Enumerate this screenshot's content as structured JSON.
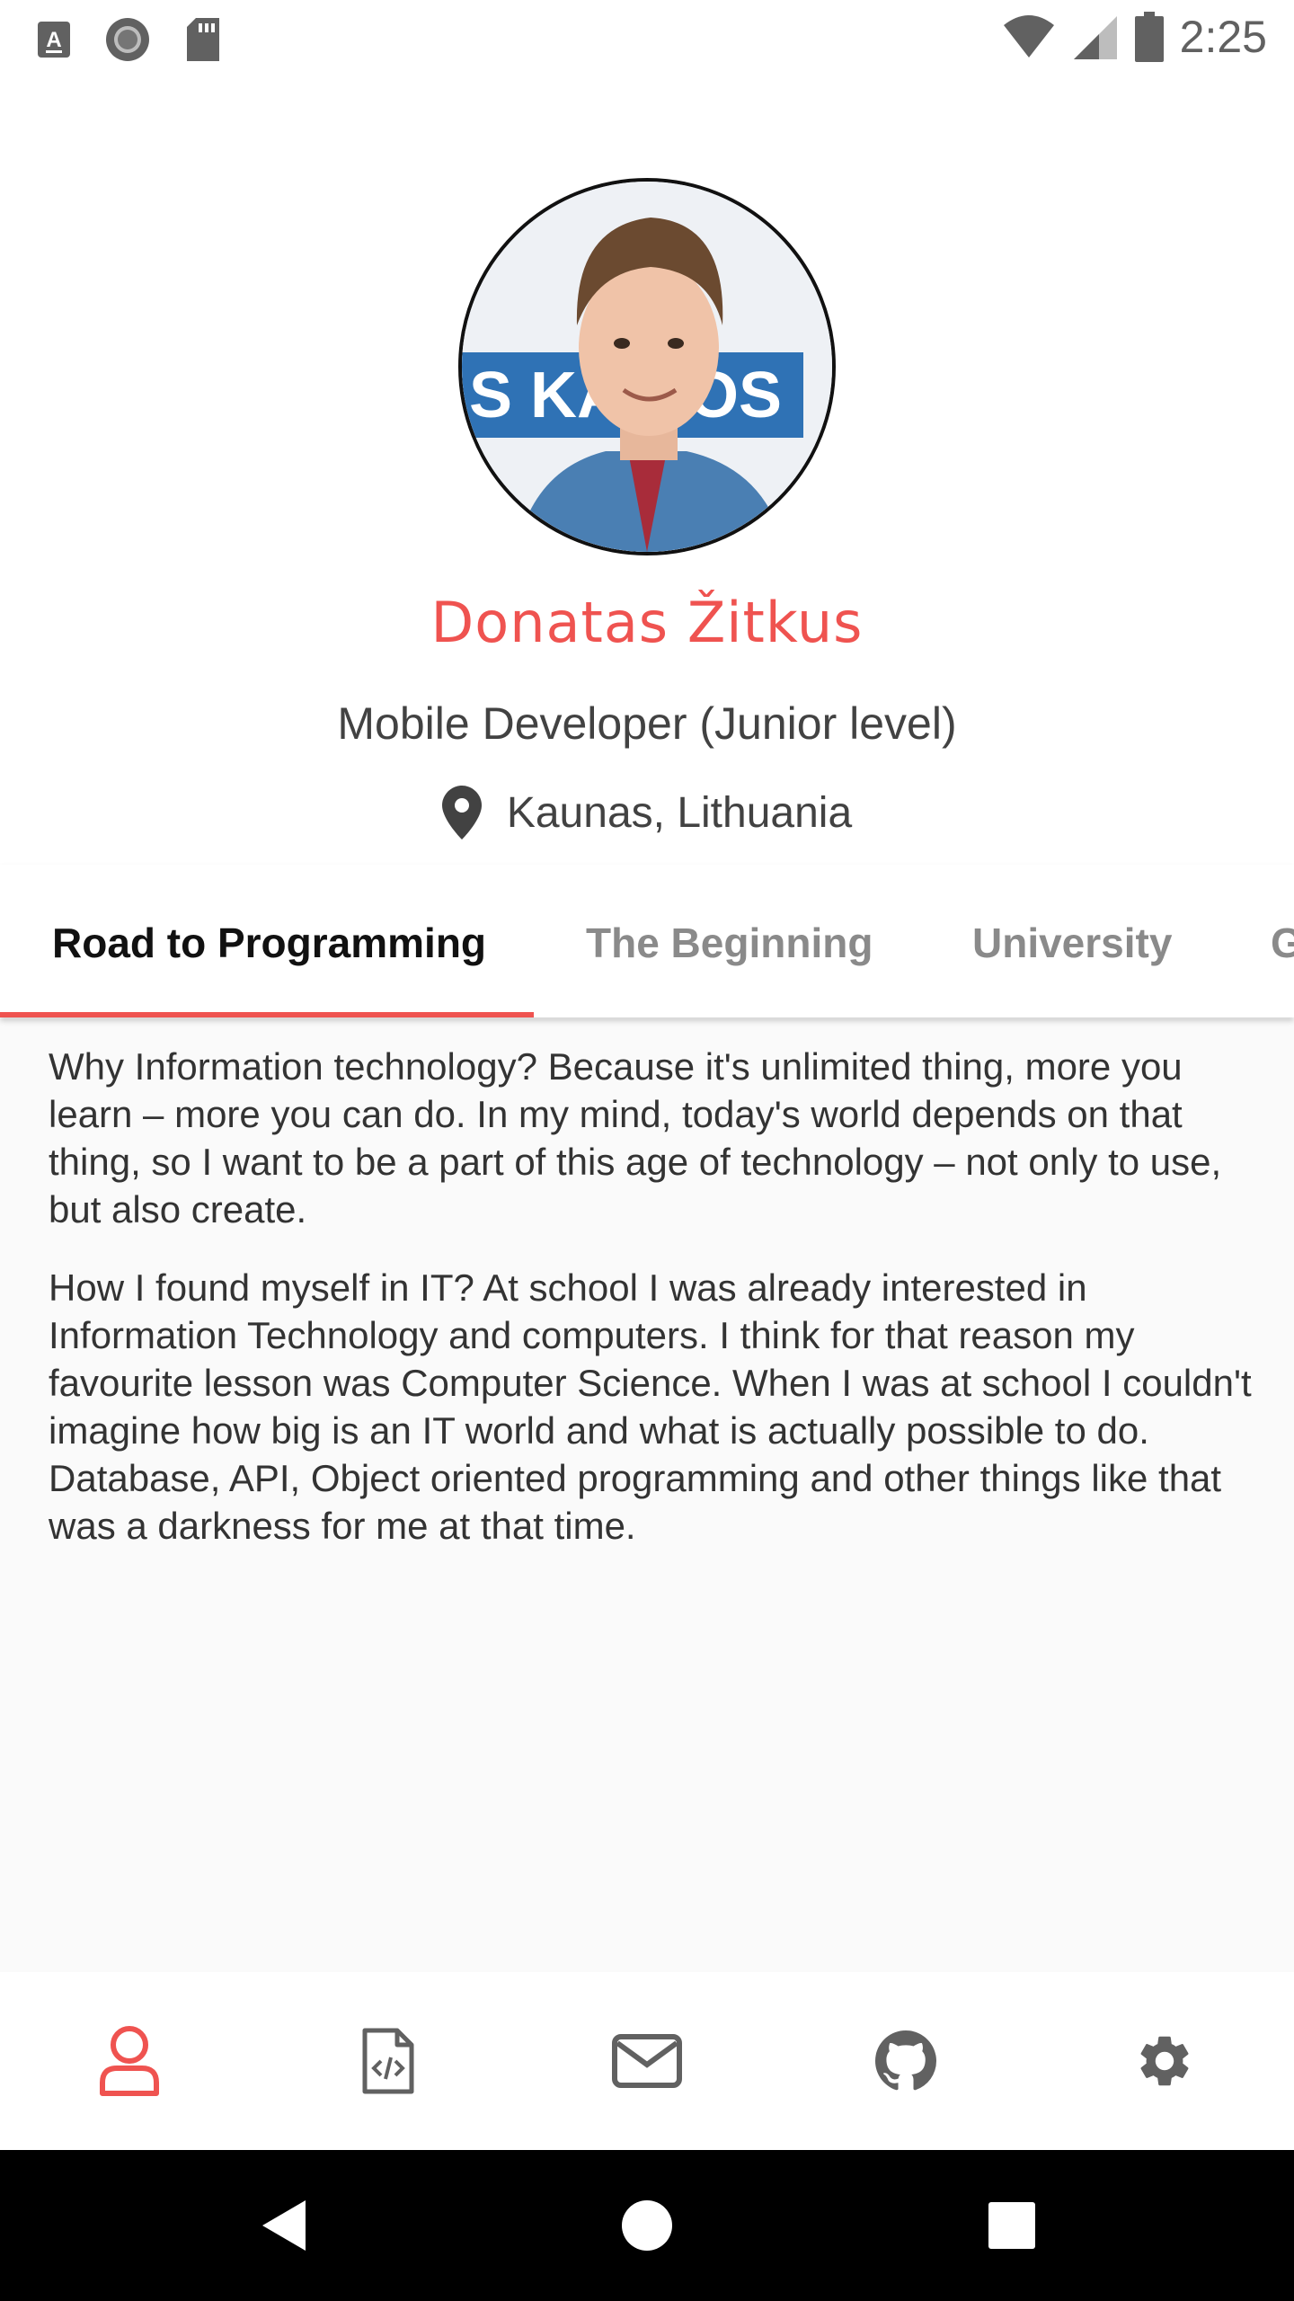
{
  "status_bar": {
    "time": "2:25",
    "left_icons": [
      "a-notification-icon",
      "circle-app-icon",
      "sd-card-icon"
    ],
    "right_icons": [
      "wifi-icon",
      "cell-signal-icon",
      "battery-icon"
    ]
  },
  "profile": {
    "name": "Donatas Žitkus",
    "role": "Mobile Developer (Junior level)",
    "location": "Kaunas, Lithuania",
    "avatar_banner_text": "S KAR  OS"
  },
  "tabs": [
    {
      "label": "Road to Programming",
      "active": true
    },
    {
      "label": "The Beginning",
      "active": false
    },
    {
      "label": "University",
      "active": false
    },
    {
      "label": "G",
      "active": false
    }
  ],
  "content": {
    "paragraphs": [
      "Why Information technology? Because it's unlimited thing, more you learn – more you can do. In my mind, today's world depends on that thing, so I want to be a part of this age of technology – not only to use, but also create.",
      "How I found myself in IT? At school I was already interested in Information Technology and computers. I think for that reason my favourite lesson was Computer Science. When I was at school I couldn't imagine how big is an IT world and what is actually possible to do. Database, API, Object oriented programming and other things like that was a darkness for me at that time."
    ]
  },
  "bottom_nav": {
    "items": [
      {
        "icon": "profile-icon",
        "active": true
      },
      {
        "icon": "code-file-icon",
        "active": false
      },
      {
        "icon": "mail-icon",
        "active": false
      },
      {
        "icon": "github-icon",
        "active": false
      },
      {
        "icon": "settings-gear-icon",
        "active": false
      }
    ]
  },
  "system_nav": [
    "back-icon",
    "home-icon",
    "recents-icon"
  ],
  "colors": {
    "accent": "#ef5350",
    "text_primary": "#111111",
    "text_secondary": "#424242",
    "tab_inactive": "#8a8a8a",
    "icon_inactive": "#616161"
  }
}
